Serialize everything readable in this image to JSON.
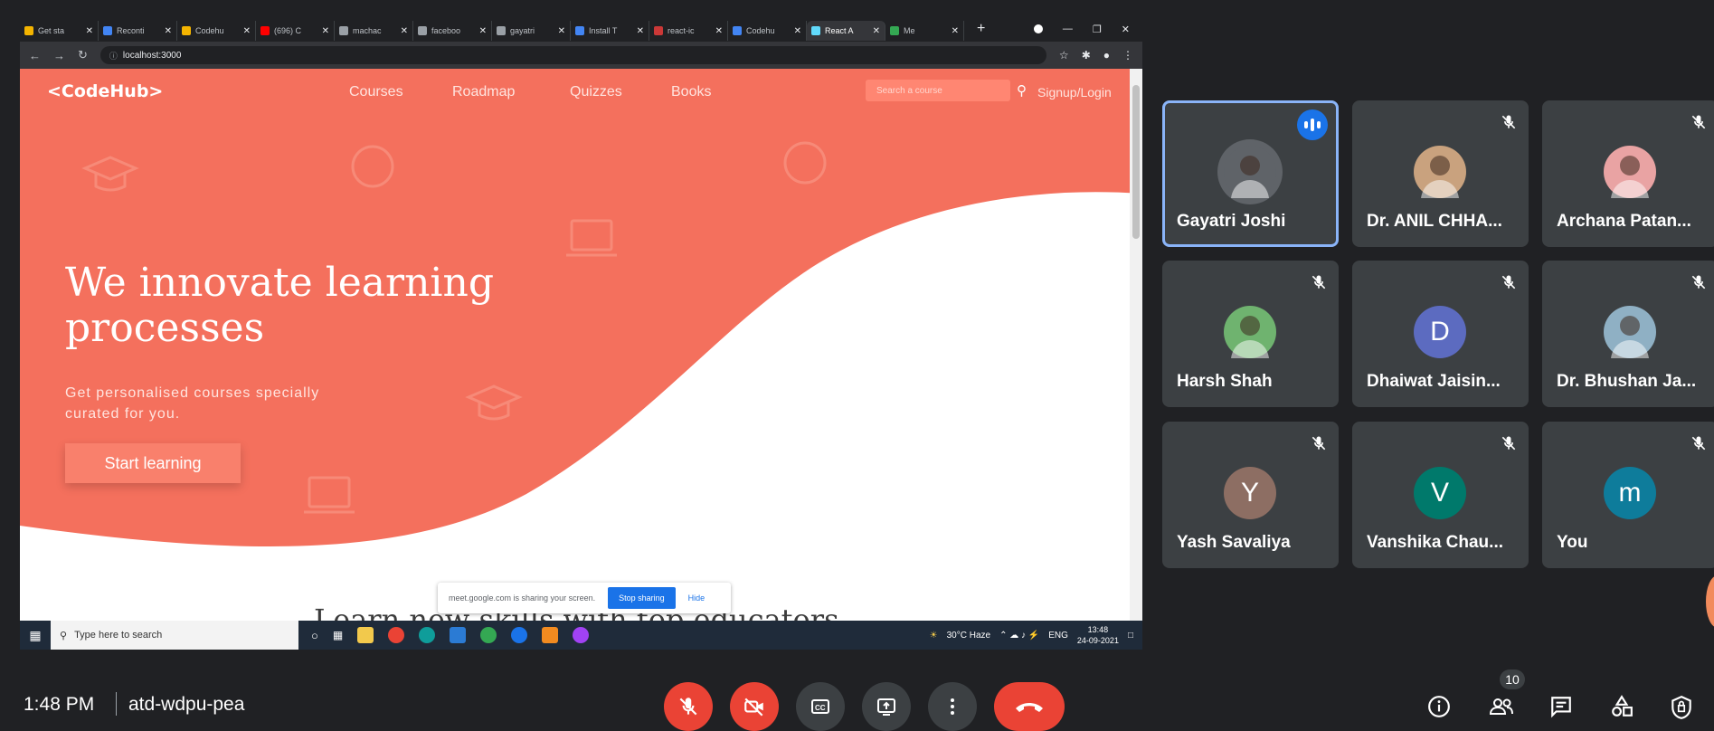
{
  "browser": {
    "tabs": [
      {
        "label": "Get sta",
        "color": "#f4b400"
      },
      {
        "label": "Reconti",
        "color": "#4285f4"
      },
      {
        "label": "Codehu",
        "color": "#f4b400"
      },
      {
        "label": "(696) C",
        "color": "#ff0000"
      },
      {
        "label": "machac",
        "color": "#9aa0a6"
      },
      {
        "label": "faceboo",
        "color": "#9aa0a6"
      },
      {
        "label": "gayatri",
        "color": "#9aa0a6"
      },
      {
        "label": "Install T",
        "color": "#4285f4"
      },
      {
        "label": "react-ic",
        "color": "#cb3837"
      },
      {
        "label": "Codehu",
        "color": "#4285f4"
      },
      {
        "label": "React A",
        "color": "#61dafb"
      },
      {
        "label": "Me",
        "color": "#34a853"
      }
    ],
    "url": "localhost:3000"
  },
  "site": {
    "logo": "<CodeHub>",
    "nav": [
      "Courses",
      "Roadmap",
      "Quizzes",
      "Books"
    ],
    "search_placeholder": "Search a course",
    "signup": "Signup/Login",
    "hero_title": "We innovate learning processes",
    "hero_sub": "Get personalised courses specially curated for you.",
    "cta": "Start learning",
    "section_heading": "Learn new skills with top educators",
    "accent": "#f4705d"
  },
  "sharing_bar": {
    "text": "meet.google.com is sharing your screen.",
    "stop": "Stop sharing",
    "hide": "Hide"
  },
  "taskbar": {
    "search": "Type here to search",
    "weather": "30°C  Haze",
    "lang": "ENG",
    "time": "13:48",
    "date": "24-09-2021"
  },
  "participants": [
    {
      "name": "Gayatri Joshi",
      "initial": "",
      "color": "#5f6368",
      "speaking": true
    },
    {
      "name": "Dr. ANIL CHHA...",
      "initial": "",
      "color": "#c9a27e",
      "speaking": false
    },
    {
      "name": "Archana Patan...",
      "initial": "",
      "color": "#e9a3a3",
      "speaking": false
    },
    {
      "name": "Harsh Shah",
      "initial": "",
      "color": "#6fb36f",
      "speaking": false
    },
    {
      "name": "Dhaiwat Jaisin...",
      "initial": "D",
      "color": "#5c6bc0",
      "speaking": false
    },
    {
      "name": "Dr. Bhushan Ja...",
      "initial": "",
      "color": "#8fb0c4",
      "speaking": false
    },
    {
      "name": "Yash Savaliya",
      "initial": "Y",
      "color": "#8d6e63",
      "speaking": false
    },
    {
      "name": "Vanshika Chau...",
      "initial": "V",
      "color": "#00796b",
      "speaking": false
    },
    {
      "name": "You",
      "initial": "m",
      "color": "#0e7c9b",
      "speaking": false
    }
  ],
  "meeting": {
    "time": "1:48 PM",
    "code": "atd-wdpu-pea",
    "people_count": "10"
  }
}
